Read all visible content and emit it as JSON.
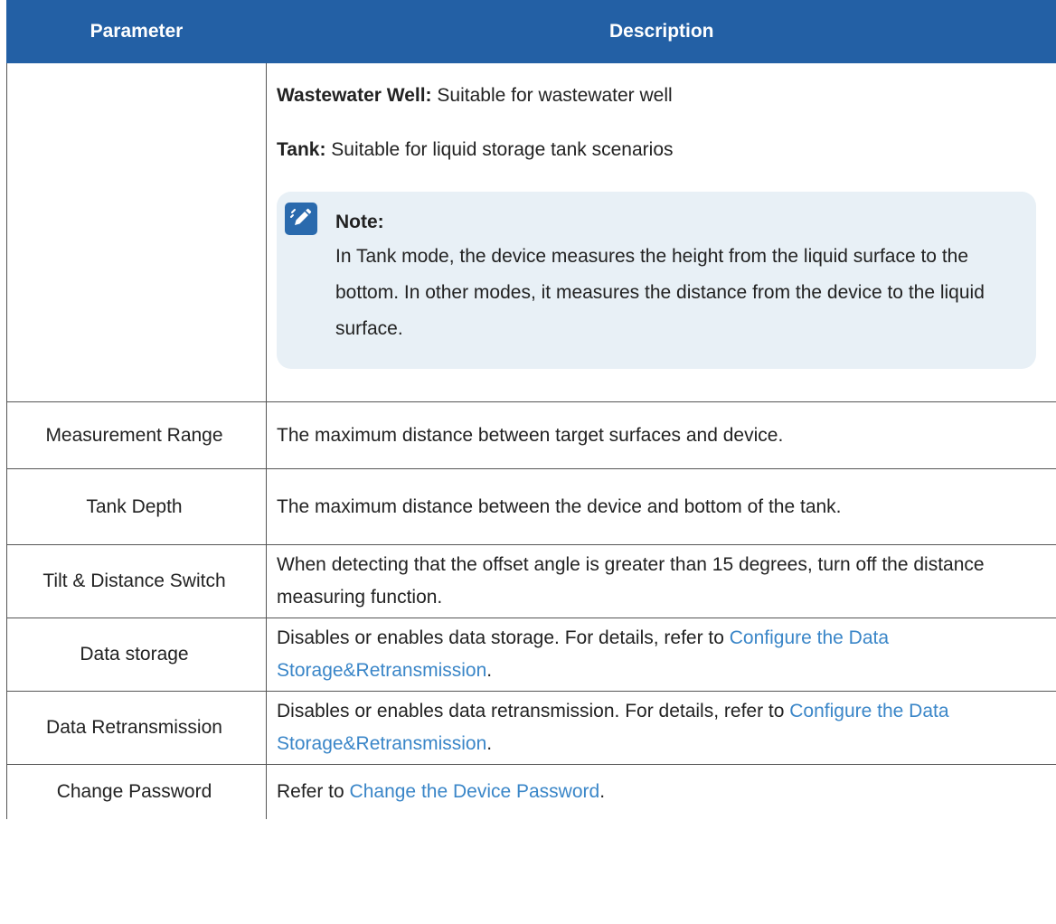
{
  "table": {
    "headers": {
      "parameter": "Parameter",
      "description": "Description"
    },
    "first_row": {
      "parameter": "",
      "lines": [
        {
          "bold": "Wastewater Well:",
          "text": " Suitable for wastewater well"
        },
        {
          "bold": "Tank:",
          "text": " Suitable for liquid storage tank scenarios"
        }
      ],
      "note": {
        "title": "Note:",
        "body": "In Tank mode, the device measures the height from the liquid surface to the bottom. In other modes, it measures the distance from the device to the liquid surface."
      }
    },
    "rows": [
      {
        "parameter": "Measurement Range",
        "description": "The maximum distance between target surfaces and device."
      },
      {
        "parameter": "Tank Depth",
        "description": "The maximum distance between the device and bottom of the tank."
      },
      {
        "parameter": "Tilt & Distance Switch",
        "description": "When detecting that the offset angle is greater than 15 degrees, turn off the distance measuring function."
      },
      {
        "parameter": "Data storage",
        "description_prefix": "Disables or enables data storage. For details, refer to ",
        "link": "Configure the Data Storage&Retransmission",
        "description_suffix": "."
      },
      {
        "parameter": "Data Retransmission",
        "description_prefix": "Disables or enables data retransmission. For details, refer to ",
        "link": "Configure the Data Storage&Retransmission",
        "description_suffix": "."
      },
      {
        "parameter": "Change Password",
        "description_prefix": "Refer to ",
        "link": "Change the Device Password",
        "description_suffix": "."
      }
    ]
  },
  "colors": {
    "header_bg": "#2360a5",
    "link": "#3a86c8",
    "note_bg": "#e8f0f6"
  },
  "icons": {
    "note": "pencil-note-icon"
  }
}
